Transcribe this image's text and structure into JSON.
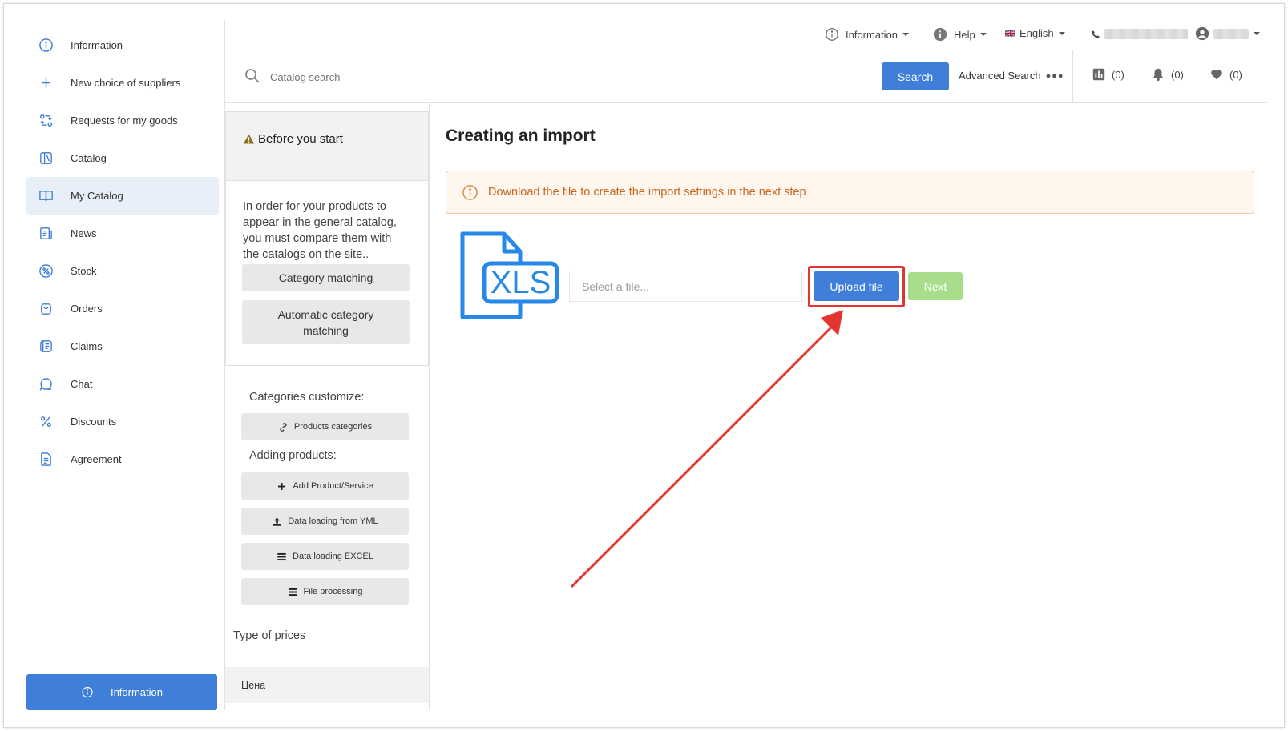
{
  "sidebar": {
    "items": [
      {
        "label": "Information",
        "icon": "info-circle-icon"
      },
      {
        "label": "New choice of suppliers",
        "icon": "plus-icon"
      },
      {
        "label": "Requests for my goods",
        "icon": "exchange-icon"
      },
      {
        "label": "Catalog",
        "icon": "catalog-icon"
      },
      {
        "label": "My Catalog",
        "icon": "book-open-icon",
        "active": true
      },
      {
        "label": "News",
        "icon": "news-icon"
      },
      {
        "label": "Stock",
        "icon": "percent-circle-icon"
      },
      {
        "label": "Orders",
        "icon": "bag-icon"
      },
      {
        "label": "Claims",
        "icon": "claims-icon"
      },
      {
        "label": "Chat",
        "icon": "chat-icon"
      },
      {
        "label": "Discounts",
        "icon": "percent-icon"
      },
      {
        "label": "Agreement",
        "icon": "document-icon"
      }
    ],
    "info_button": "Information"
  },
  "topbar": {
    "information": "Information",
    "help": "Help",
    "language": "English"
  },
  "search": {
    "placeholder": "Catalog search",
    "button": "Search",
    "advanced": "Advanced Search"
  },
  "counters": {
    "compare": "(0)",
    "notifications": "(0)",
    "favorites": "(0)"
  },
  "left_panel": {
    "before_title": "Before you start",
    "order_text": "In order for your products to appear in the general catalog, you must compare them with the catalogs on the site..",
    "category_matching": "Category matching",
    "auto_category_matching": "Automatic category matching",
    "categories_customize": "Categories customize:",
    "products_categories": "Products categories",
    "adding_products": "Adding products:",
    "add_product": "Add Product/Service",
    "data_loading_yml": "Data loading from YML",
    "data_loading_excel": "Data loading EXCEL",
    "file_processing": "File processing",
    "type_of_prices": "Type of prices",
    "price_type": "Цена"
  },
  "main": {
    "title": "Creating an import",
    "alert": "Download the file to create the import settings in the next step",
    "file_icon_text": "XLS",
    "file_placeholder": "Select a file...",
    "upload_button": "Upload file",
    "next_button": "Next"
  },
  "colors": {
    "primary": "#3f7fd9",
    "next_disabled": "#a8dd8c",
    "alert_text": "#c5691f",
    "highlight": "#e3342f"
  }
}
